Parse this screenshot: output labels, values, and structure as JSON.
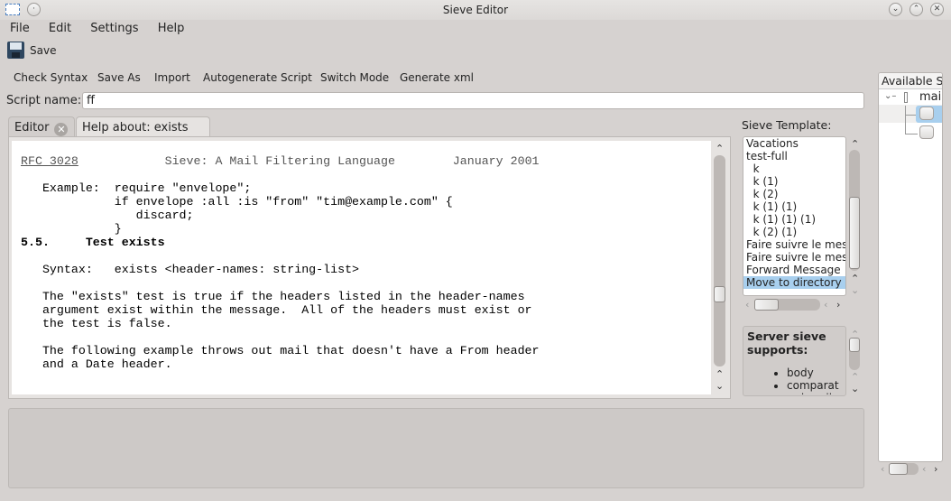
{
  "window": {
    "title": "Sieve Editor",
    "buttons": [
      "minimize",
      "maximize",
      "close"
    ]
  },
  "menu": [
    "File",
    "Edit",
    "Settings",
    "Help"
  ],
  "toolbar": {
    "save": "Save"
  },
  "actions": [
    "Check Syntax",
    "Save As",
    "Import",
    "Autogenerate Script",
    "Switch Mode",
    "Generate xml"
  ],
  "script": {
    "label": "Script name:",
    "value": "ff"
  },
  "tabs": [
    {
      "label": "Editor",
      "active": false
    },
    {
      "label": "Help about: exists",
      "active": true
    }
  ],
  "help_text": {
    "header_left": "RFC 3028",
    "header_rest": "            Sieve: A Mail Filtering Language        January 2001",
    "body_top": "\n\n   Example:  require \"envelope\";\n             if envelope :all :is \"from\" \"tim@example.com\" {\n                discard;\n             }\n",
    "heading": "5.5.     Test exists",
    "body_bottom": "\n\n   Syntax:   exists <header-names: string-list>\n\n   The \"exists\" test is true if the headers listed in the header-names\n   argument exist within the message.  All of the headers must exist or\n   the test is false.\n\n   The following example throws out mail that doesn't have a From header\n   and a Date header."
  },
  "templates": {
    "label": "Sieve Template:",
    "items": [
      "Vacations",
      "test-full",
      "  k",
      "  k (1)",
      "  k (2)",
      "  k (1) (1)",
      "  k (1) (1) (1)",
      "  k (2) (1)",
      "Faire suivre le message",
      "Faire suivre le message",
      "Forward Message",
      "Move to directory"
    ],
    "selected": "Move to directory"
  },
  "server": {
    "title": "Server sieve supports:",
    "items": [
      "body",
      "comparator-i;ascii"
    ]
  },
  "available": {
    "header": "Available Scripts",
    "root": "mail"
  },
  "colors": {
    "selection": "#a8cfee",
    "active_close": "#d9341f"
  }
}
